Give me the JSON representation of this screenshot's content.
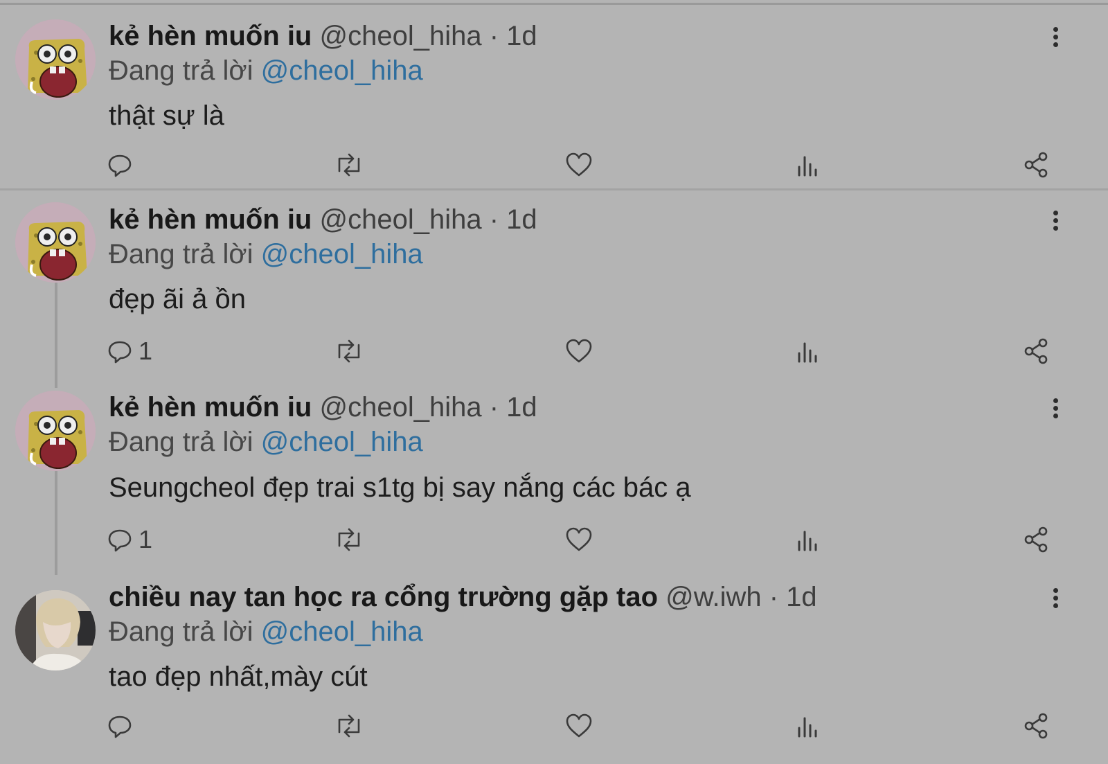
{
  "colors": {
    "background": "#b4b4b4",
    "mention": "#2e6e9e",
    "name": "#181818",
    "meta": "#3e3e3e"
  },
  "tweets": [
    {
      "name": "kẻ hèn muốn iu",
      "handle": "@cheol_hiha",
      "separator": "·",
      "time": "1d",
      "reply_prefix": "Đang trả lời",
      "reply_to": "@cheol_hiha",
      "text": "thật sự là",
      "reply_count": "",
      "avatar_icon": "spongebob-avatar-icon"
    },
    {
      "name": "kẻ hèn muốn iu",
      "handle": "@cheol_hiha",
      "separator": "·",
      "time": "1d",
      "reply_prefix": "Đang trả lời",
      "reply_to": "@cheol_hiha",
      "text": "đẹp ãi ả ồn",
      "reply_count": "1",
      "avatar_icon": "spongebob-avatar-icon"
    },
    {
      "name": "kẻ hèn muốn iu",
      "handle": "@cheol_hiha",
      "separator": "·",
      "time": "1d",
      "reply_prefix": "Đang trả lời",
      "reply_to": "@cheol_hiha",
      "text": "Seungcheol đẹp trai s1tg bị say nắng các bác ạ",
      "reply_count": "1",
      "avatar_icon": "spongebob-avatar-icon"
    },
    {
      "name": "chiều nay tan học ra cổng trường gặp tao",
      "handle": "@w.iwh",
      "separator": "·",
      "time": "1d",
      "reply_prefix": "Đang trả lời",
      "reply_to": "@cheol_hiha",
      "text": "tao đẹp nhất,mày cút",
      "reply_count": "",
      "avatar_icon": "person-photo-avatar-icon"
    }
  ],
  "action_icons": [
    "reply-icon",
    "retweet-icon",
    "like-icon",
    "views-icon",
    "share-icon",
    "more-options-icon"
  ]
}
